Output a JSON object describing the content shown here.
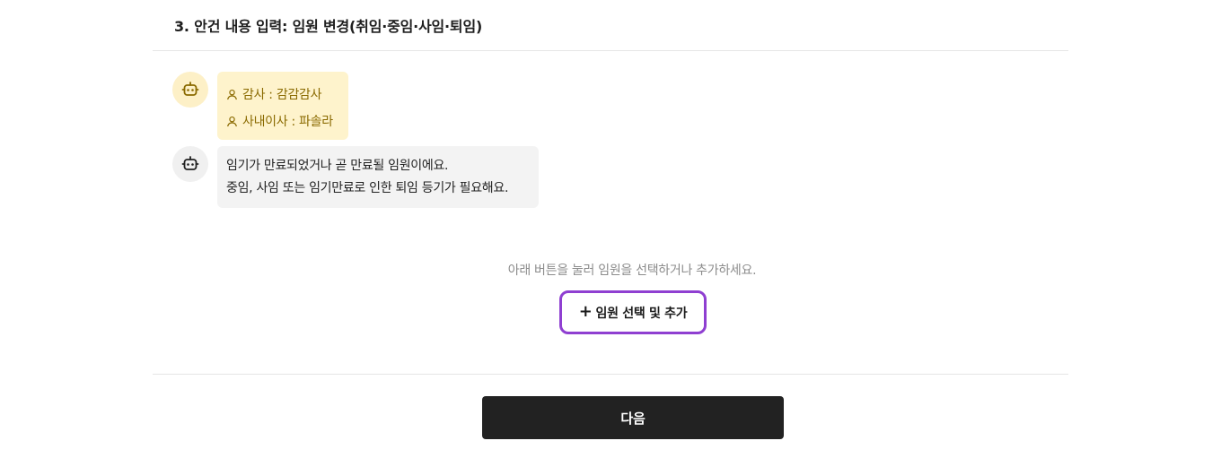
{
  "section": {
    "title": "3. 안건 내용 입력: 임원 변경(취임·중임·사임·퇴임)"
  },
  "officers_message": {
    "items": [
      {
        "label": "감사 : 감감감사"
      },
      {
        "label": "사내이사 : 파솔라"
      }
    ]
  },
  "bot_message": {
    "line1": "임기가 만료되었거나 곧 만료될 임원이에요.",
    "line2": "중임, 사임 또는 임기만료로 인한 퇴임 등기가 필요해요."
  },
  "hint": "아래 버튼을 눌러 임원을 선택하거나 추가하세요.",
  "add_button": {
    "plus": "+",
    "label": "임원 선택 및 추가"
  },
  "next_button": {
    "label": "다음"
  },
  "colors": {
    "accent_border": "#8f3fd1",
    "officer_bubble": "#fef3cc",
    "officer_text": "#8a6a00",
    "next_button_bg": "#222222"
  }
}
